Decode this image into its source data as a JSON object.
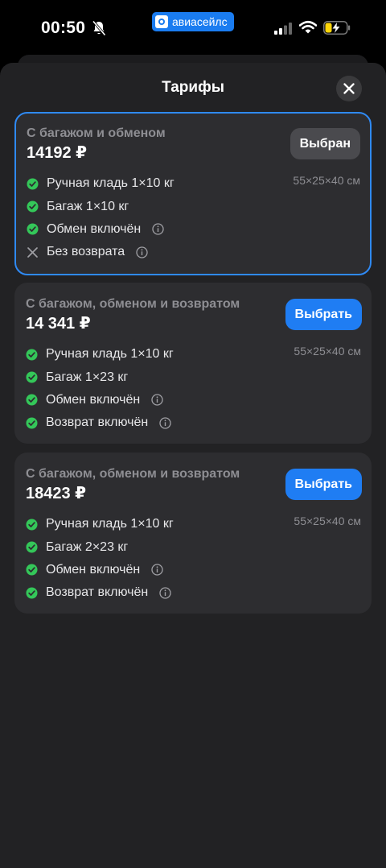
{
  "status_bar": {
    "time": "00:50",
    "app_pill": "авиасейлс",
    "icons": [
      "bell-slash-icon",
      "cellular-signal-icon",
      "wifi-icon",
      "battery-charging-icon"
    ]
  },
  "sheet": {
    "title": "Тарифы",
    "close_icon": "close-icon"
  },
  "tariffs": [
    {
      "title": "С багажом и обменом",
      "price": "14192 ₽",
      "button": "Выбран",
      "selected": true,
      "dims": "55×25×40 см",
      "features": [
        {
          "text": "Ручная кладь 1×10 кг",
          "status": "included",
          "info": false
        },
        {
          "text": "Багаж 1×10 кг",
          "status": "included",
          "info": false
        },
        {
          "text": "Обмен включён",
          "status": "included",
          "info": true
        },
        {
          "text": "Без возврата",
          "status": "excluded",
          "info": true
        }
      ]
    },
    {
      "title": "С багажом, обменом и возвратом",
      "price": "14 341 ₽",
      "button": "Выбрать",
      "selected": false,
      "dims": "55×25×40 см",
      "features": [
        {
          "text": "Ручная кладь 1×10 кг",
          "status": "included",
          "info": false
        },
        {
          "text": "Багаж 1×23 кг",
          "status": "included",
          "info": false
        },
        {
          "text": "Обмен включён",
          "status": "included",
          "info": true
        },
        {
          "text": "Возврат включён",
          "status": "included",
          "info": true
        }
      ]
    },
    {
      "title": "С багажом, обменом и возвратом",
      "price": "18423 ₽",
      "button": "Выбрать",
      "selected": false,
      "dims": "55×25×40 см",
      "features": [
        {
          "text": "Ручная кладь 1×10 кг",
          "status": "included",
          "info": false
        },
        {
          "text": "Багаж 2×23 кг",
          "status": "included",
          "info": false
        },
        {
          "text": "Обмен включён",
          "status": "included",
          "info": true
        },
        {
          "text": "Возврат включён",
          "status": "included",
          "info": true
        }
      ]
    }
  ],
  "colors": {
    "accent": "#1f7df3",
    "check": "#34c759",
    "sheet_bg": "#222224",
    "card_bg": "#2d2d30",
    "selected_border": "#2f8af5"
  }
}
